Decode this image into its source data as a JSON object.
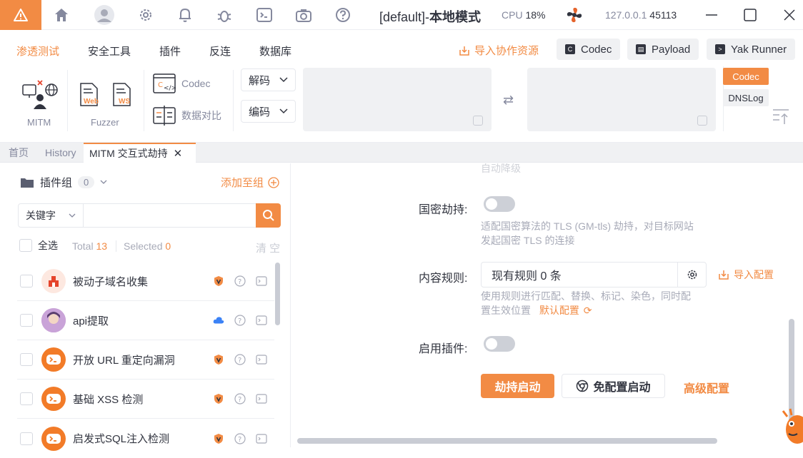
{
  "titlebar": {
    "title_prefix": "[default]-",
    "title_mode": "本地模式",
    "cpu_label": "CPU",
    "cpu_value": "18%",
    "addr_ip": "127.0.0.1",
    "addr_port": "45113"
  },
  "menu": {
    "items": [
      "渗透测试",
      "安全工具",
      "插件",
      "反连",
      "数据库"
    ],
    "import_label": "导入协作资源",
    "buttons": [
      "Codec",
      "Payload",
      "Yak Runner"
    ]
  },
  "toolbar": {
    "mitm_label": "MITM",
    "fuzzer_label": "Fuzzer",
    "web_tag": "Web",
    "ws_tag": "WS",
    "codec_link": "Codec",
    "compare_link": "数据对比",
    "decode_select": "解码",
    "encode_select": "编码",
    "side_tabs": [
      "Codec",
      "DNSLog"
    ]
  },
  "tabs": [
    "首页",
    "History",
    "MITM 交互式劫持"
  ],
  "left": {
    "group_label": "插件组",
    "group_count": "0",
    "add_to_group": "添加至组",
    "keyword_select": "关键字",
    "select_all": "全选",
    "total_label": "Total",
    "total_value": "13",
    "selected_label": "Selected",
    "selected_value": "0",
    "clear_label": "清 空",
    "plugins": [
      {
        "name": "被动子域名收集",
        "badge": "shield"
      },
      {
        "name": "api提取",
        "badge": "cloud"
      },
      {
        "name": "开放 URL 重定向漏洞",
        "badge": "shield"
      },
      {
        "name": "基础 XSS 检测",
        "badge": "shield"
      },
      {
        "name": "启发式SQL注入检测",
        "badge": "shield"
      }
    ]
  },
  "right": {
    "top_faded_text": "自动降级",
    "gm_label": "国密劫持:",
    "gm_help_1": "适配国密算法的 TLS (GM-tls) 劫持，对目标网站",
    "gm_help_2": "发起国密 TLS 的连接",
    "rules_label": "内容规则:",
    "rules_value": "现有规则 0 条",
    "import_config": "导入配置",
    "rules_help_1": "使用规则进行匹配、替换、标记、染色，同时配",
    "rules_help_2": "置生效位置",
    "default_config": "默认配置",
    "plugin_label": "启用插件:",
    "btn_start": "劫持启动",
    "btn_free": "免配置启动",
    "btn_adv": "高级配置"
  },
  "colors": {
    "accent": "#f28b44",
    "text": "#31343f",
    "muted": "#85899e"
  }
}
